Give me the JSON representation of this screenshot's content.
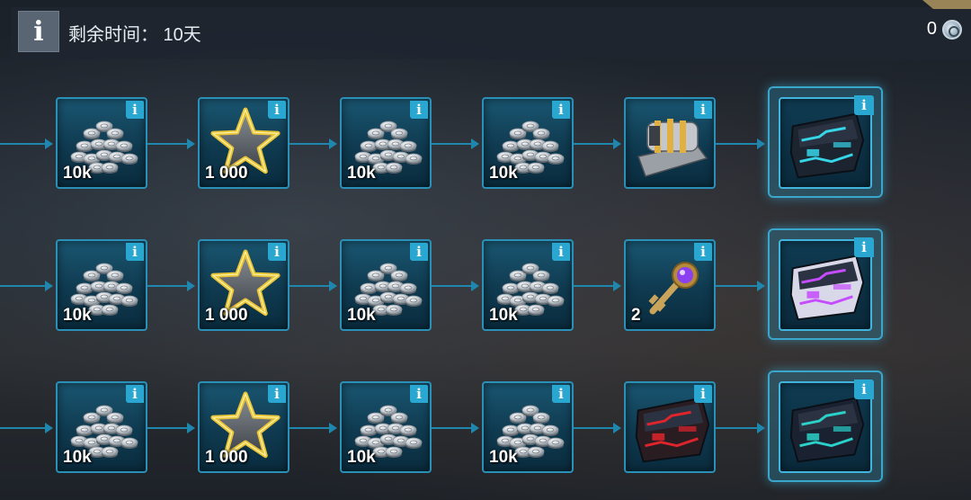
{
  "header": {
    "info_icon": "info-icon",
    "info_glyph": "i",
    "time_label": "剩余时间： 10天",
    "currency_value": "0",
    "currency_icon": "gear-coin-icon"
  },
  "colors": {
    "tile_border": "#2a90b8",
    "connector": "#1f86ad",
    "badge": "#2aa7d0"
  },
  "rows": [
    {
      "rewards": [
        {
          "icon": "silver-coins-icon",
          "qty": "10k"
        },
        {
          "icon": "gold-star-icon",
          "qty": "1 000"
        },
        {
          "icon": "silver-coins-icon",
          "qty": "10k"
        },
        {
          "icon": "silver-coins-icon",
          "qty": "10k"
        },
        {
          "icon": "gold-striped-armor-icon",
          "qty": ""
        }
      ],
      "final": {
        "icon": "cyan-armor-piece-icon",
        "qty": ""
      }
    },
    {
      "rewards": [
        {
          "icon": "silver-coins-icon",
          "qty": "10k"
        },
        {
          "icon": "gold-star-icon",
          "qty": "1 000"
        },
        {
          "icon": "silver-coins-icon",
          "qty": "10k"
        },
        {
          "icon": "silver-coins-icon",
          "qty": "10k"
        },
        {
          "icon": "purple-key-icon",
          "qty": "2"
        }
      ],
      "final": {
        "icon": "purple-armor-piece-icon",
        "qty": ""
      }
    },
    {
      "rewards": [
        {
          "icon": "silver-coins-icon",
          "qty": "10k"
        },
        {
          "icon": "gold-star-icon",
          "qty": "1 000"
        },
        {
          "icon": "silver-coins-icon",
          "qty": "10k"
        },
        {
          "icon": "silver-coins-icon",
          "qty": "10k"
        },
        {
          "icon": "red-armor-piece-icon",
          "qty": ""
        }
      ],
      "final": {
        "icon": "teal-armor-piece-icon",
        "qty": ""
      }
    }
  ]
}
